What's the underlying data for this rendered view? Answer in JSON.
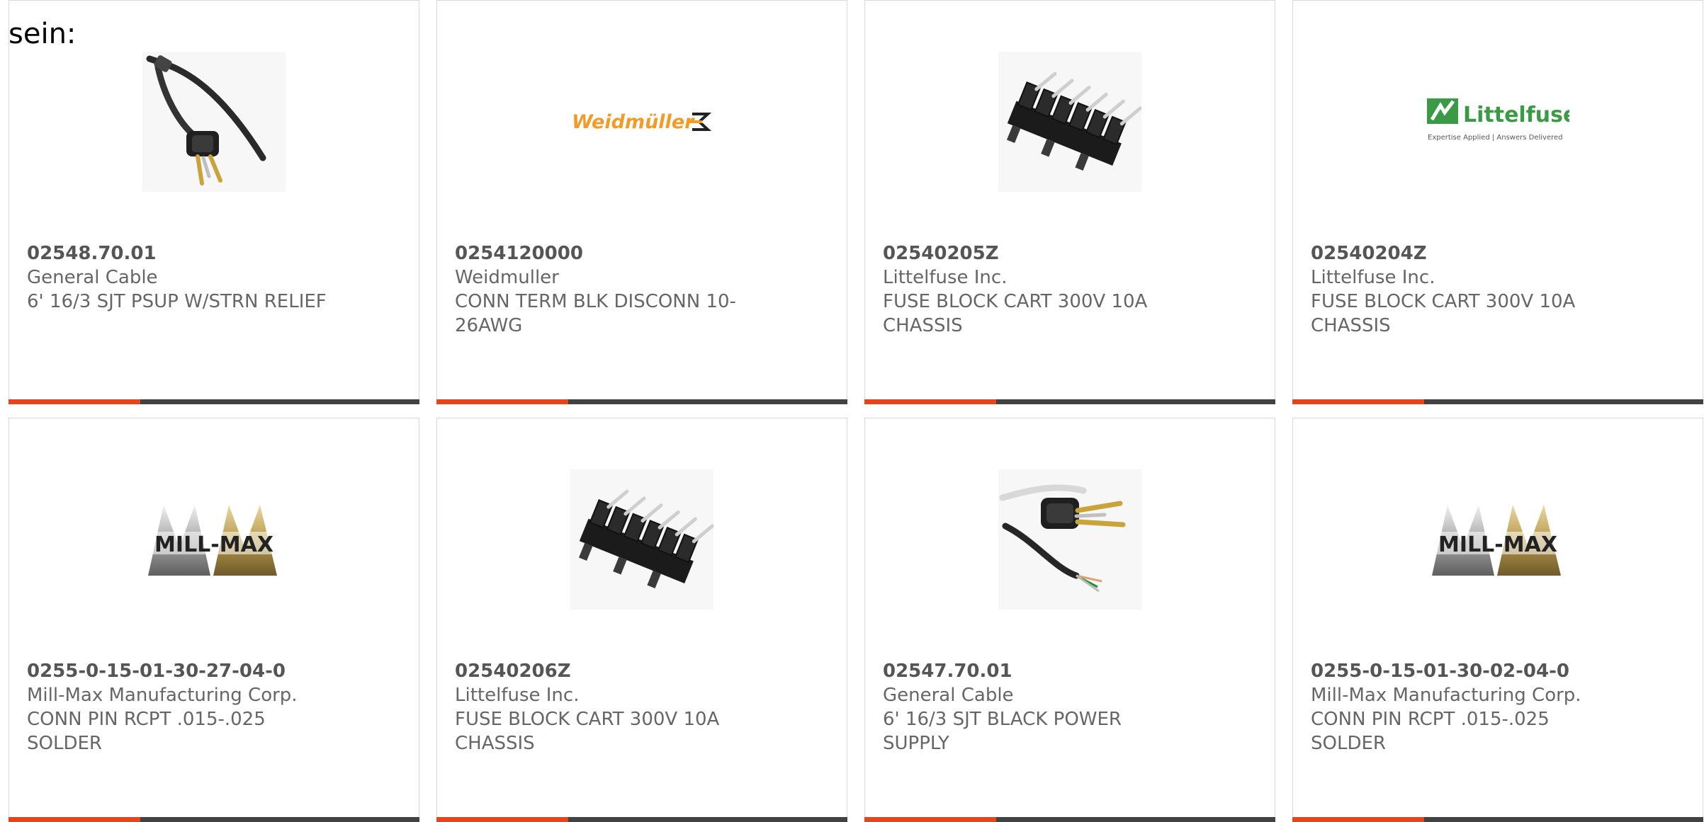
{
  "page": {
    "heading": "sein:"
  },
  "colors": {
    "accent": "#e8441b",
    "bar": "#424242",
    "border": "#d9d9d9",
    "text": "#666666"
  },
  "products": [
    {
      "part_number": "02548.70.01",
      "manufacturer": "General Cable",
      "description": "6' 16/3 SJT PSUP W/STRN RELIEF",
      "image": "power-cord-strain-relief-icon",
      "progress": 0.32
    },
    {
      "part_number": "0254120000",
      "manufacturer": "Weidmuller",
      "description": "CONN TERM BLK DISCONN 10-26AWG",
      "image": "weidmuller-logo",
      "logo_text": "Weidmüller",
      "progress": 0.32
    },
    {
      "part_number": "02540205Z",
      "manufacturer": "Littelfuse Inc.",
      "description": "FUSE BLOCK CART 300V 10A CHASSIS",
      "image": "fuse-block-icon",
      "progress": 0.32
    },
    {
      "part_number": "02540204Z",
      "manufacturer": "Littelfuse Inc.",
      "description": "FUSE BLOCK CART 300V 10A CHASSIS",
      "image": "littelfuse-logo",
      "logo_text": "Littelfuse",
      "logo_tagline": "Expertise Applied | Answers Delivered",
      "progress": 0.32
    },
    {
      "part_number": "0255-0-15-01-30-27-04-0",
      "manufacturer": "Mill-Max Manufacturing Corp.",
      "description": "CONN PIN RCPT .015-.025 SOLDER",
      "image": "mill-max-logo",
      "logo_text": "MILL-MAX",
      "progress": 0.32
    },
    {
      "part_number": "02540206Z",
      "manufacturer": "Littelfuse Inc.",
      "description": "FUSE BLOCK CART 300V 10A CHASSIS",
      "image": "fuse-block-icon",
      "progress": 0.32
    },
    {
      "part_number": "02547.70.01",
      "manufacturer": "General Cable",
      "description": "6' 16/3 SJT BLACK POWER SUPPLY",
      "image": "power-cord-bare-wires-icon",
      "progress": 0.32
    },
    {
      "part_number": "0255-0-15-01-30-02-04-0",
      "manufacturer": "Mill-Max Manufacturing Corp.",
      "description": "CONN PIN RCPT .015-.025 SOLDER",
      "image": "mill-max-logo",
      "logo_text": "MILL-MAX",
      "progress": 0.32
    }
  ]
}
